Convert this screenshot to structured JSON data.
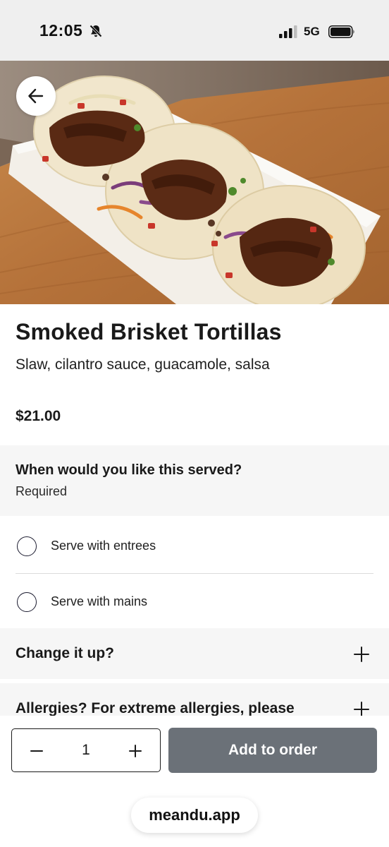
{
  "status_bar": {
    "time": "12:05",
    "network": "5G",
    "icons": [
      "bell-slash-icon",
      "signal-icon",
      "battery-icon"
    ]
  },
  "hero": {
    "image": "smoked-brisket-tortillas-photo"
  },
  "nav": {
    "back_icon": "arrow-left-icon"
  },
  "item": {
    "title": "Smoked Brisket Tortillas",
    "description": "Slaw, cilantro sauce, guacamole, salsa",
    "price": "$21.00"
  },
  "serve": {
    "question": "When would you like this served?",
    "required": "Required",
    "options": [
      {
        "label": "Serve with entrees",
        "selected": false
      },
      {
        "label": "Serve with mains",
        "selected": false
      }
    ]
  },
  "sections": {
    "change": {
      "label": "Change it up?"
    },
    "allergies": {
      "label": "Allergies? For extreme allergies, please"
    }
  },
  "order": {
    "quantity": "1",
    "add_label": "Add to order"
  },
  "footer": {
    "domain": "meandu.app"
  },
  "colors": {
    "add_button": "#6b7178",
    "section_bg": "#f6f6f6",
    "status_bg": "#efefef"
  }
}
